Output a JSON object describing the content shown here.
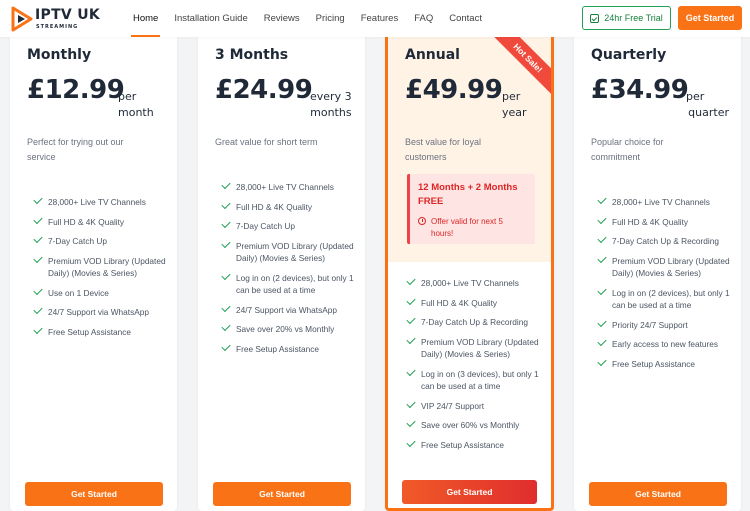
{
  "brand": {
    "name": "IPTV UK",
    "sub": "STREAMING"
  },
  "nav": {
    "items": [
      "Home",
      "Installation Guide",
      "Reviews",
      "Pricing",
      "Features",
      "FAQ",
      "Contact"
    ],
    "trial_label": "24hr Free Trial",
    "start_label": "Get Started"
  },
  "colors": {
    "accent": "#f97316",
    "check": "#22a155",
    "alert": "#dc2626"
  },
  "plans": [
    {
      "name": "Monthly",
      "price": "£12.99",
      "period_1": "per",
      "period_2": "month",
      "desc_1": "Perfect for trying out our",
      "desc_2": "service",
      "features": [
        "28,000+ Live TV Channels",
        "Full HD & 4K Quality",
        "7-Day Catch Up",
        "Premium VOD Library (Updated Daily) (Movies & Series)",
        "Use on 1 Device",
        "24/7 Support via WhatsApp",
        "Free Setup Assistance"
      ],
      "cta": "Get Started"
    },
    {
      "name": "3 Months",
      "price": "£24.99",
      "period_1": "every 3",
      "period_2": "months",
      "desc_1": "Great value for short term",
      "desc_2": "",
      "features": [
        "28,000+ Live TV Channels",
        "Full HD & 4K Quality",
        "7-Day Catch Up",
        "Premium VOD Library (Updated Daily) (Movies & Series)",
        "Log in on (2 devices), but only 1 can be used at a time",
        "24/7 Support via WhatsApp",
        "Save over 20% vs Monthly",
        "Free Setup Assistance"
      ],
      "cta": "Get Started"
    },
    {
      "name": "Annual",
      "price": "£49.99",
      "period_1": "per",
      "period_2": "year",
      "ribbon": "Hot Sale!",
      "desc_1": "Best value for loyal",
      "desc_2": "customers",
      "offer_title": "12 Months + 2 Months FREE",
      "offer_note": "Offer valid for next 5 hours!",
      "features": [
        "28,000+ Live TV Channels",
        "Full HD & 4K Quality",
        "7-Day Catch Up & Recording",
        "Premium VOD Library (Updated Daily) (Movies & Series)",
        "Log in on (3 devices), but only 1 can be used at a time",
        "VIP 24/7 Support",
        "Save over 60% vs Monthly",
        "Free Setup Assistance"
      ],
      "cta": "Get Started"
    },
    {
      "name": "Quarterly",
      "price": "£34.99",
      "period_1": "per",
      "period_2": "quarter",
      "desc_1": "Popular choice for",
      "desc_2": "commitment",
      "features": [
        "28,000+ Live TV Channels",
        "Full HD & 4K Quality",
        "7-Day Catch Up & Recording",
        "Premium VOD Library (Updated Daily) (Movies & Series)",
        "Log in on (2 devices), but only 1 can be used at a time",
        "Priority 24/7 Support",
        "Early access to new features",
        "Free Setup Assistance"
      ],
      "cta": "Get Started"
    }
  ]
}
